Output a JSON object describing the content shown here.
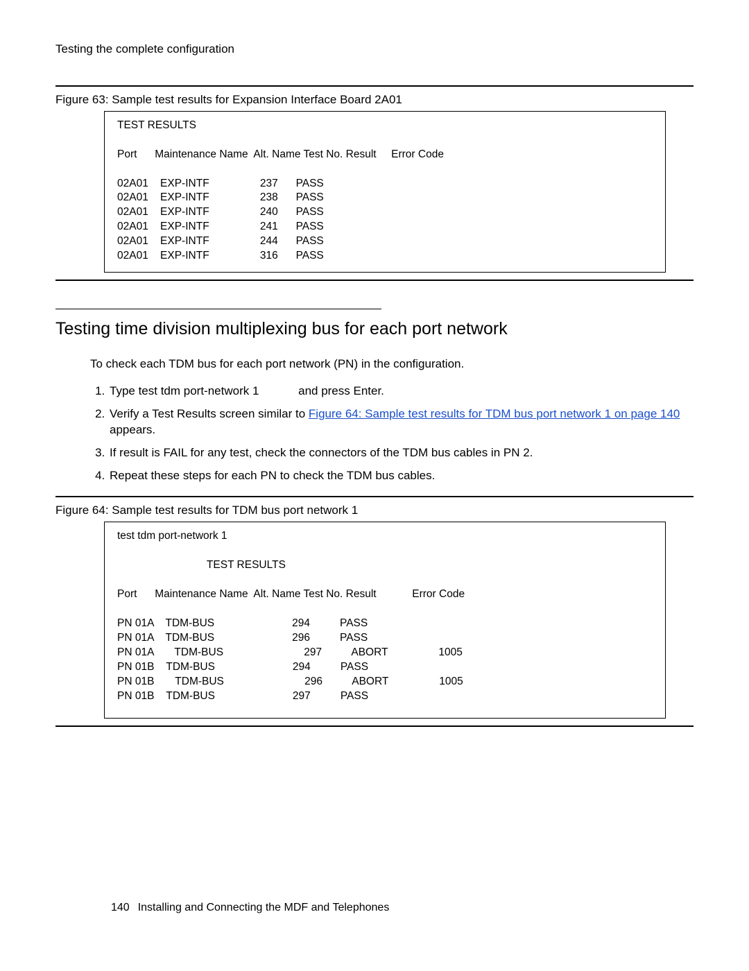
{
  "header": "Testing the complete configuration",
  "figure63": {
    "caption": "Figure 63: Sample test results for Expansion Interface Board 2A01",
    "box_title": "TEST RESULTS",
    "col_header": "Port      Maintenance Name  Alt. Name Test No. Result     Error Code",
    "rows": [
      "02A01    EXP-INTF                 237      PASS",
      "02A01    EXP-INTF                 238      PASS",
      "02A01    EXP-INTF                 240      PASS",
      "02A01    EXP-INTF                 241      PASS",
      "02A01    EXP-INTF                 244      PASS",
      "02A01    EXP-INTF                 316      PASS"
    ]
  },
  "section": {
    "title": "Testing time division multiplexing bus for each port network",
    "intro": "To check each TDM bus for each port network (PN) in the configuration.",
    "step1_a": "Type test tdm port-network 1",
    "step1_b": "and press Enter.",
    "step2_a": "Verify a Test Results screen similar to ",
    "step2_link": "Figure 64:  Sample test results for TDM bus port network 1 on page 140",
    "step2_b": " appears.",
    "step3": "If result is FAIL for any test, check the connectors of the TDM bus cables in PN 2.",
    "step4": "Repeat these steps for each PN to check the TDM bus cables."
  },
  "figure64": {
    "caption": "Figure 64: Sample test results for TDM bus port network 1",
    "cmd": "test tdm port-network 1",
    "box_title": "TEST RESULTS",
    "col_header": "Port      Maintenance Name  Alt. Name Test No. Result            Error Code",
    "rows": [
      "PN 01A    TDM-BUS                          294          PASS",
      "PN 01A    TDM-BUS                          296          PASS",
      "PN 01A       TDM-BUS                           297          ABORT                 1005",
      "PN 01B    TDM-BUS                          294          PASS",
      "PN 01B       TDM-BUS                           296          ABORT                 1005",
      "PN 01B    TDM-BUS                          297          PASS"
    ]
  },
  "footer": {
    "page": "140",
    "title": "Installing and Connecting the MDF and Telephones"
  }
}
